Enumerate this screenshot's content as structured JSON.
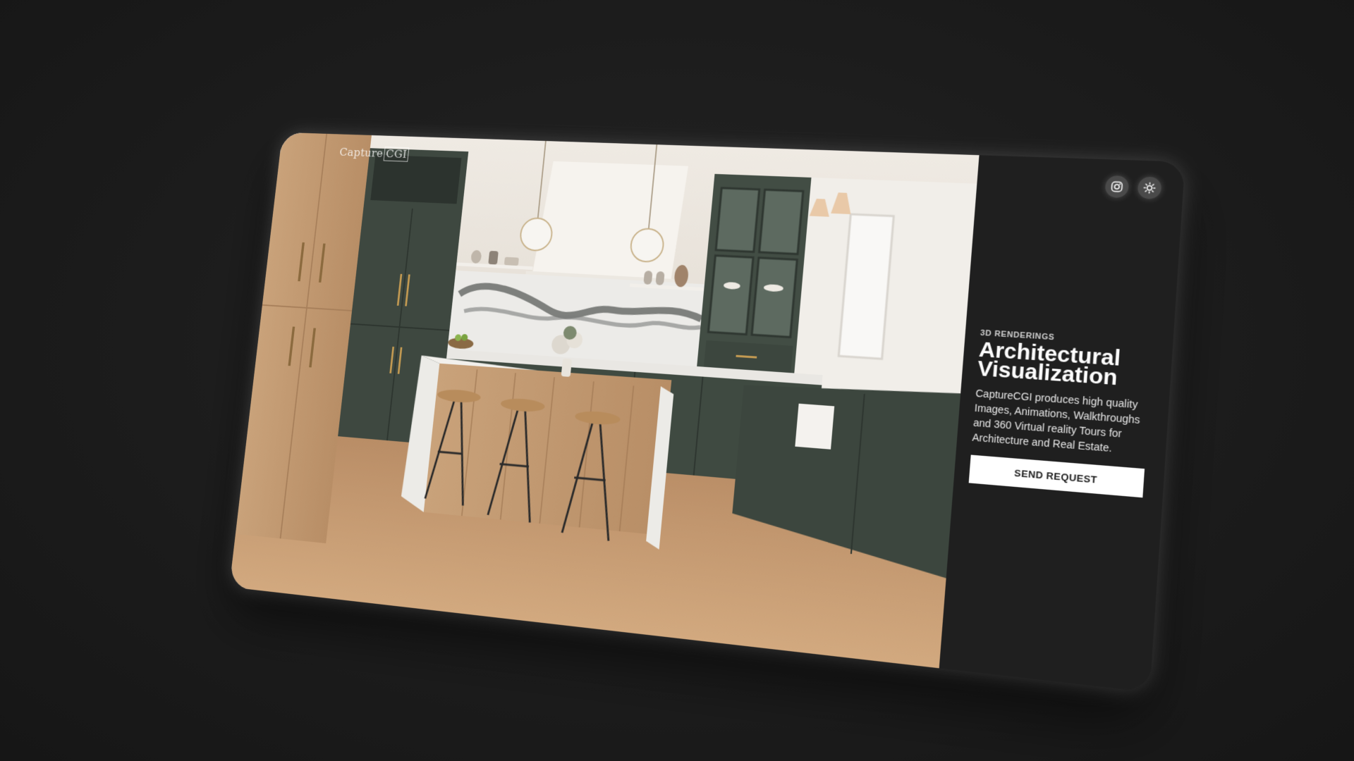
{
  "brand": {
    "logo_word": "Capture",
    "logo_mark": "CGI"
  },
  "header": {
    "icons": [
      "instagram-icon",
      "sun-icon"
    ]
  },
  "hero": {
    "eyebrow": "3D RENDERINGS",
    "title_line1": "Architectural",
    "title_line2": "Visualization",
    "description": "CaptureCGI produces high quality Images, Animations, Walkthroughs and 360 Virtual reality Tours for Architecture and Real Estate.",
    "cta_label": "SEND REQUEST"
  },
  "colors": {
    "background": "#1b1b1b",
    "panel": "#1f1f1f",
    "cabinet_green": "#3f4a41",
    "wood": "#c9a27a",
    "button_bg": "#ffffff",
    "button_text": "#1c1c1c"
  }
}
